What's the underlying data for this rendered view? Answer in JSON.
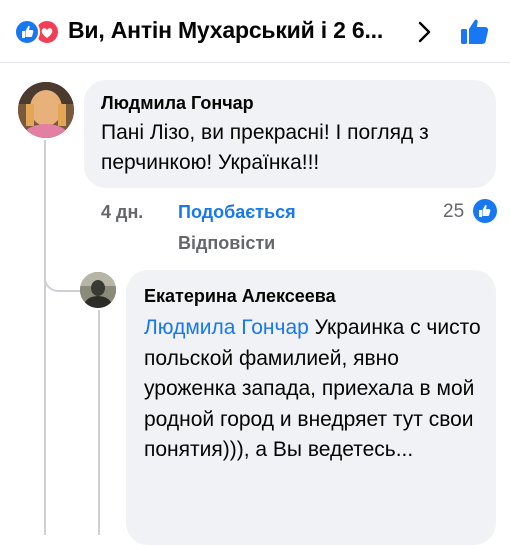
{
  "header": {
    "title": "Ви, Антін Мухарський і 2 6...",
    "reactions": [
      "like-icon",
      "love-icon"
    ],
    "chevron": "chevron-right-icon",
    "like_button": "like-icon"
  },
  "comments": [
    {
      "author": "Людмила Гончар",
      "text": "Пані Лізо, ви прекрасні! І погляд з перчинкою! Українка!!!",
      "time": "4 дн.",
      "like_label": "Подобається",
      "reply_label": "Відповісти",
      "reaction_count": "25"
    },
    {
      "author": "Екатерина Алексеева",
      "mention": "Людмила Гончар",
      "text": " Украинка с чисто польской фамилией, явно уроженка запада, приехала в мой родной город и внедряет тут свои понятия))), а Вы ведетесь..."
    }
  ],
  "colors": {
    "accent": "#1877f2",
    "love": "#f33e58",
    "bubble": "#f0f2f5",
    "secondary_text": "#65676b"
  }
}
